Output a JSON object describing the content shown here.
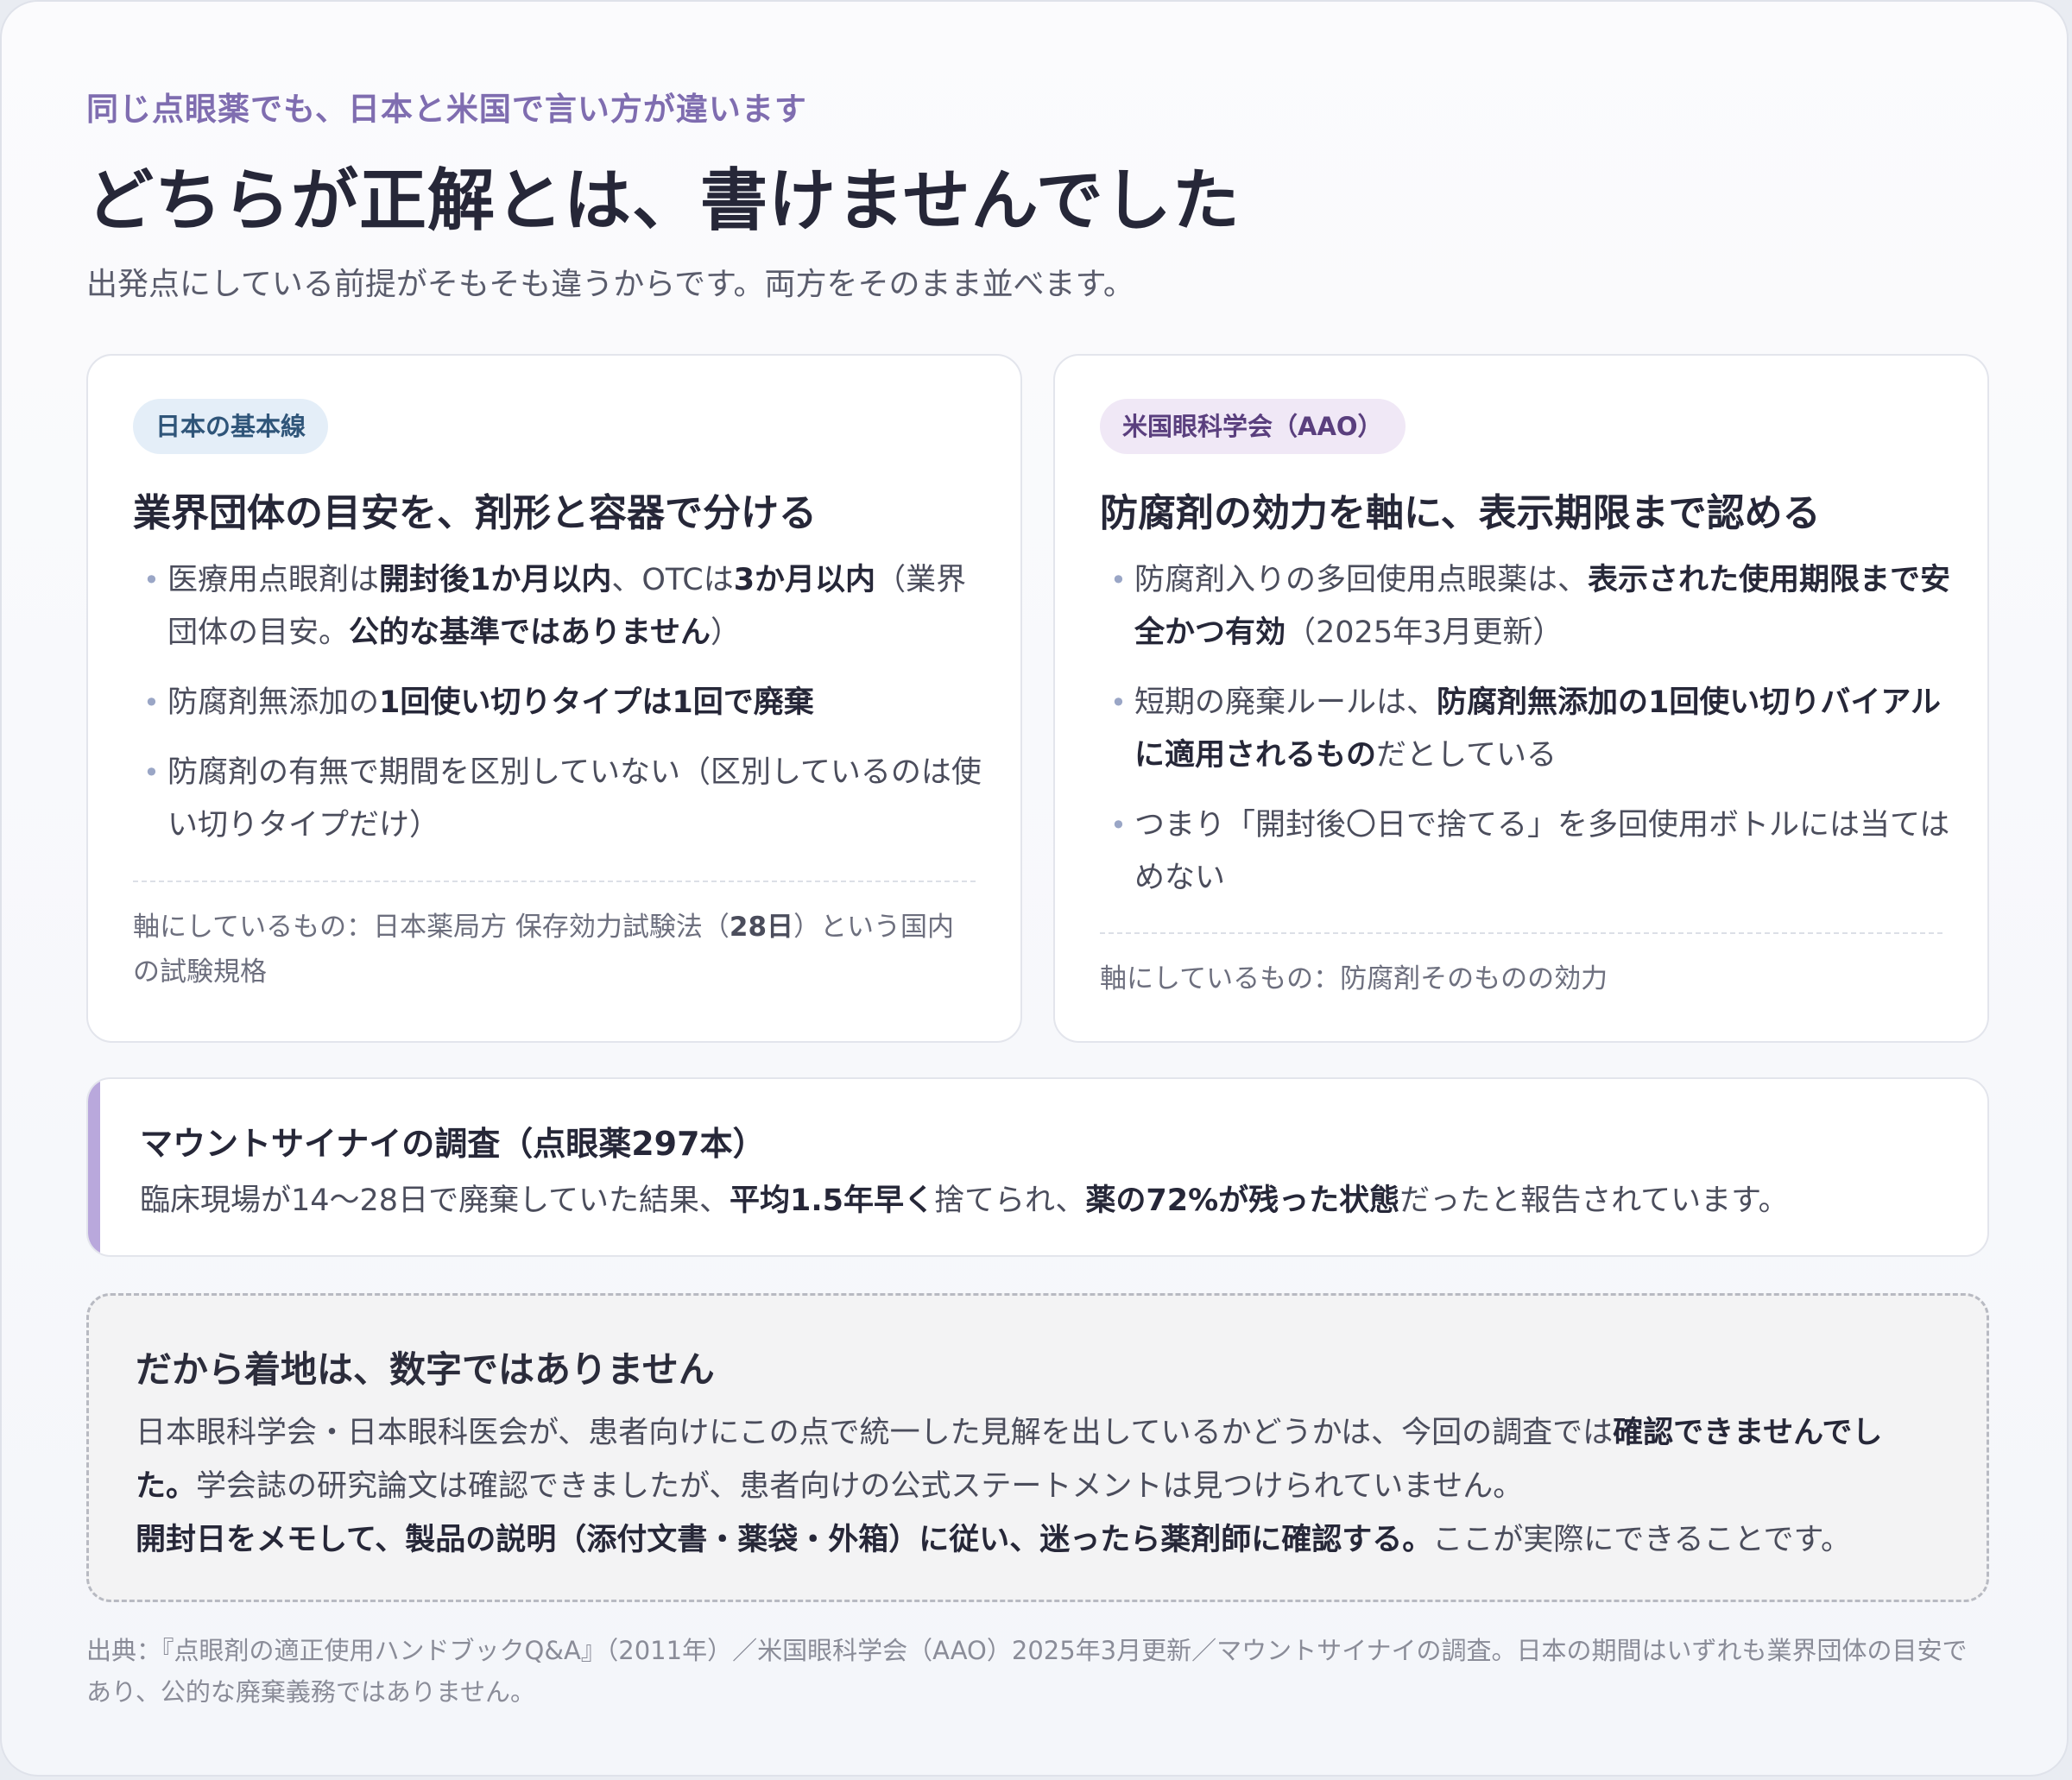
{
  "header": {
    "eyebrow": "同じ点眼薬でも、日本と米国で言い方が違います",
    "title": "どちらが正解とは、書けませんでした",
    "lede": "出発点にしている前提がそもそも違うからです。両方をそのまま並べます。"
  },
  "cards": {
    "japan": {
      "badge": "日本の基本線",
      "heading": "業界団体の目安を、剤形と容器で分ける",
      "bullet": "•",
      "points": [
        {
          "t1": "医療用点眼剤は",
          "b1": "開封後1か月以内",
          "t2": "、OTCは",
          "b2": "3か月以内",
          "t3": "（業界団体の目安。",
          "b3": "公的な基準ではありません",
          "t4": "）"
        },
        {
          "t1": "防腐剤無添加の",
          "b1": "1回使い切りタイプは1回で廃棄"
        },
        {
          "t1": "防腐剤の有無で期間を区別していない（区別しているのは使い切りタイプだけ）"
        }
      ],
      "axis": {
        "t1": "軸にしているもの：日本薬局方 保存効力試験法（",
        "b1": "28日",
        "t2": "）という国内の試験規格"
      }
    },
    "us": {
      "badge": "米国眼科学会（AAO）",
      "heading": "防腐剤の効力を軸に、表示期限まで認める",
      "bullet": "•",
      "points": [
        {
          "t1": "防腐剤入りの多回使用点眼薬は、",
          "b1": "表示された使用期限まで安全かつ有効",
          "t2": "（2025年3月更新）"
        },
        {
          "t1": "短期の廃棄ルールは、",
          "b1": "防腐剤無添加の1回使い切りバイアルに適用されるもの",
          "t2": "だとしている"
        },
        {
          "t1": "つまり「開封後〇日で捨てる」を多回使用ボトルには当てはめない"
        }
      ],
      "axis": {
        "t1": "軸にしているもの：防腐剤そのものの効力"
      }
    }
  },
  "study": {
    "title": "マウントサイナイの調査（点眼薬297本）",
    "t1": "臨床現場が14〜28日で廃棄していた結果、",
    "b1": "平均1.5年早く",
    "t2": "捨てられ、",
    "b2": "薬の72%が残った状態",
    "t3": "だったと報告されています。"
  },
  "conclusion": {
    "title": "だから着地は、数字ではありません",
    "p1_t1": "日本眼科学会・日本眼科医会が、患者向けにこの点で統一した見解を出しているかどうかは、今回の調査では",
    "p1_b1": "確認できませんでした。",
    "p1_t2": "学会誌の研究論文は確認できましたが、患者向けの公式ステートメントは見つけられていません。",
    "p2_b1": "開封日をメモして、製品の説明（添付文書・薬袋・外箱）に従い、迷ったら薬剤師に確認する。",
    "p2_t1": "ここが実際にできることです。"
  },
  "source": "出典：『点眼剤の適正使用ハンドブックQ&A』（2011年）／米国眼科学会（AAO）2025年3月更新／マウントサイナイの調査。日本の期間はいずれも業界団体の目安であり、公的な廃棄義務ではありません。"
}
